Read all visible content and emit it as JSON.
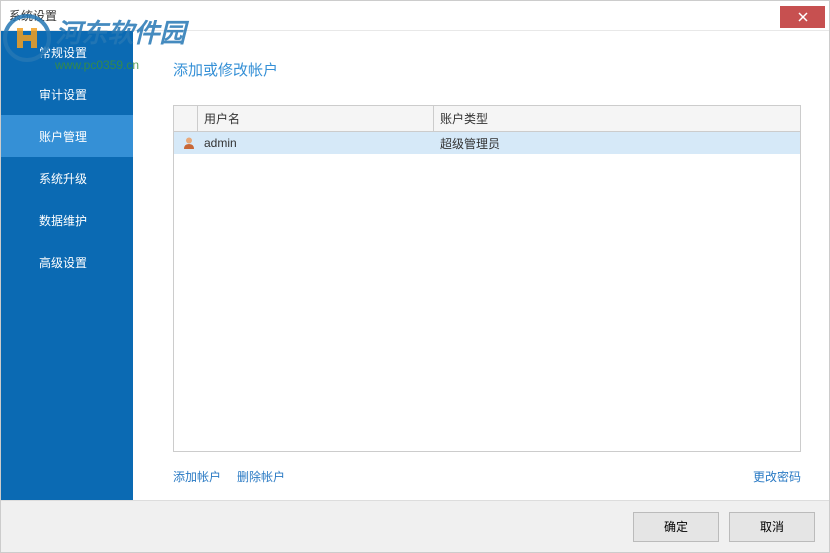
{
  "window": {
    "title": "系统设置"
  },
  "watermark": {
    "text": "河东软件园",
    "url": "www.pc0359.cn"
  },
  "sidebar": {
    "items": [
      {
        "label": "常规设置",
        "active": false
      },
      {
        "label": "审计设置",
        "active": false
      },
      {
        "label": "账户管理",
        "active": true
      },
      {
        "label": "系统升级",
        "active": false
      },
      {
        "label": "数据维护",
        "active": false
      },
      {
        "label": "高级设置",
        "active": false
      }
    ]
  },
  "main": {
    "title": "添加或修改帐户",
    "table": {
      "headers": {
        "username": "用户名",
        "type": "账户类型"
      },
      "rows": [
        {
          "username": "admin",
          "type": "超级管理员"
        }
      ]
    },
    "actions": {
      "add": "添加帐户",
      "remove": "删除帐户",
      "changepw": "更改密码"
    }
  },
  "footer": {
    "ok": "确定",
    "cancel": "取消"
  }
}
